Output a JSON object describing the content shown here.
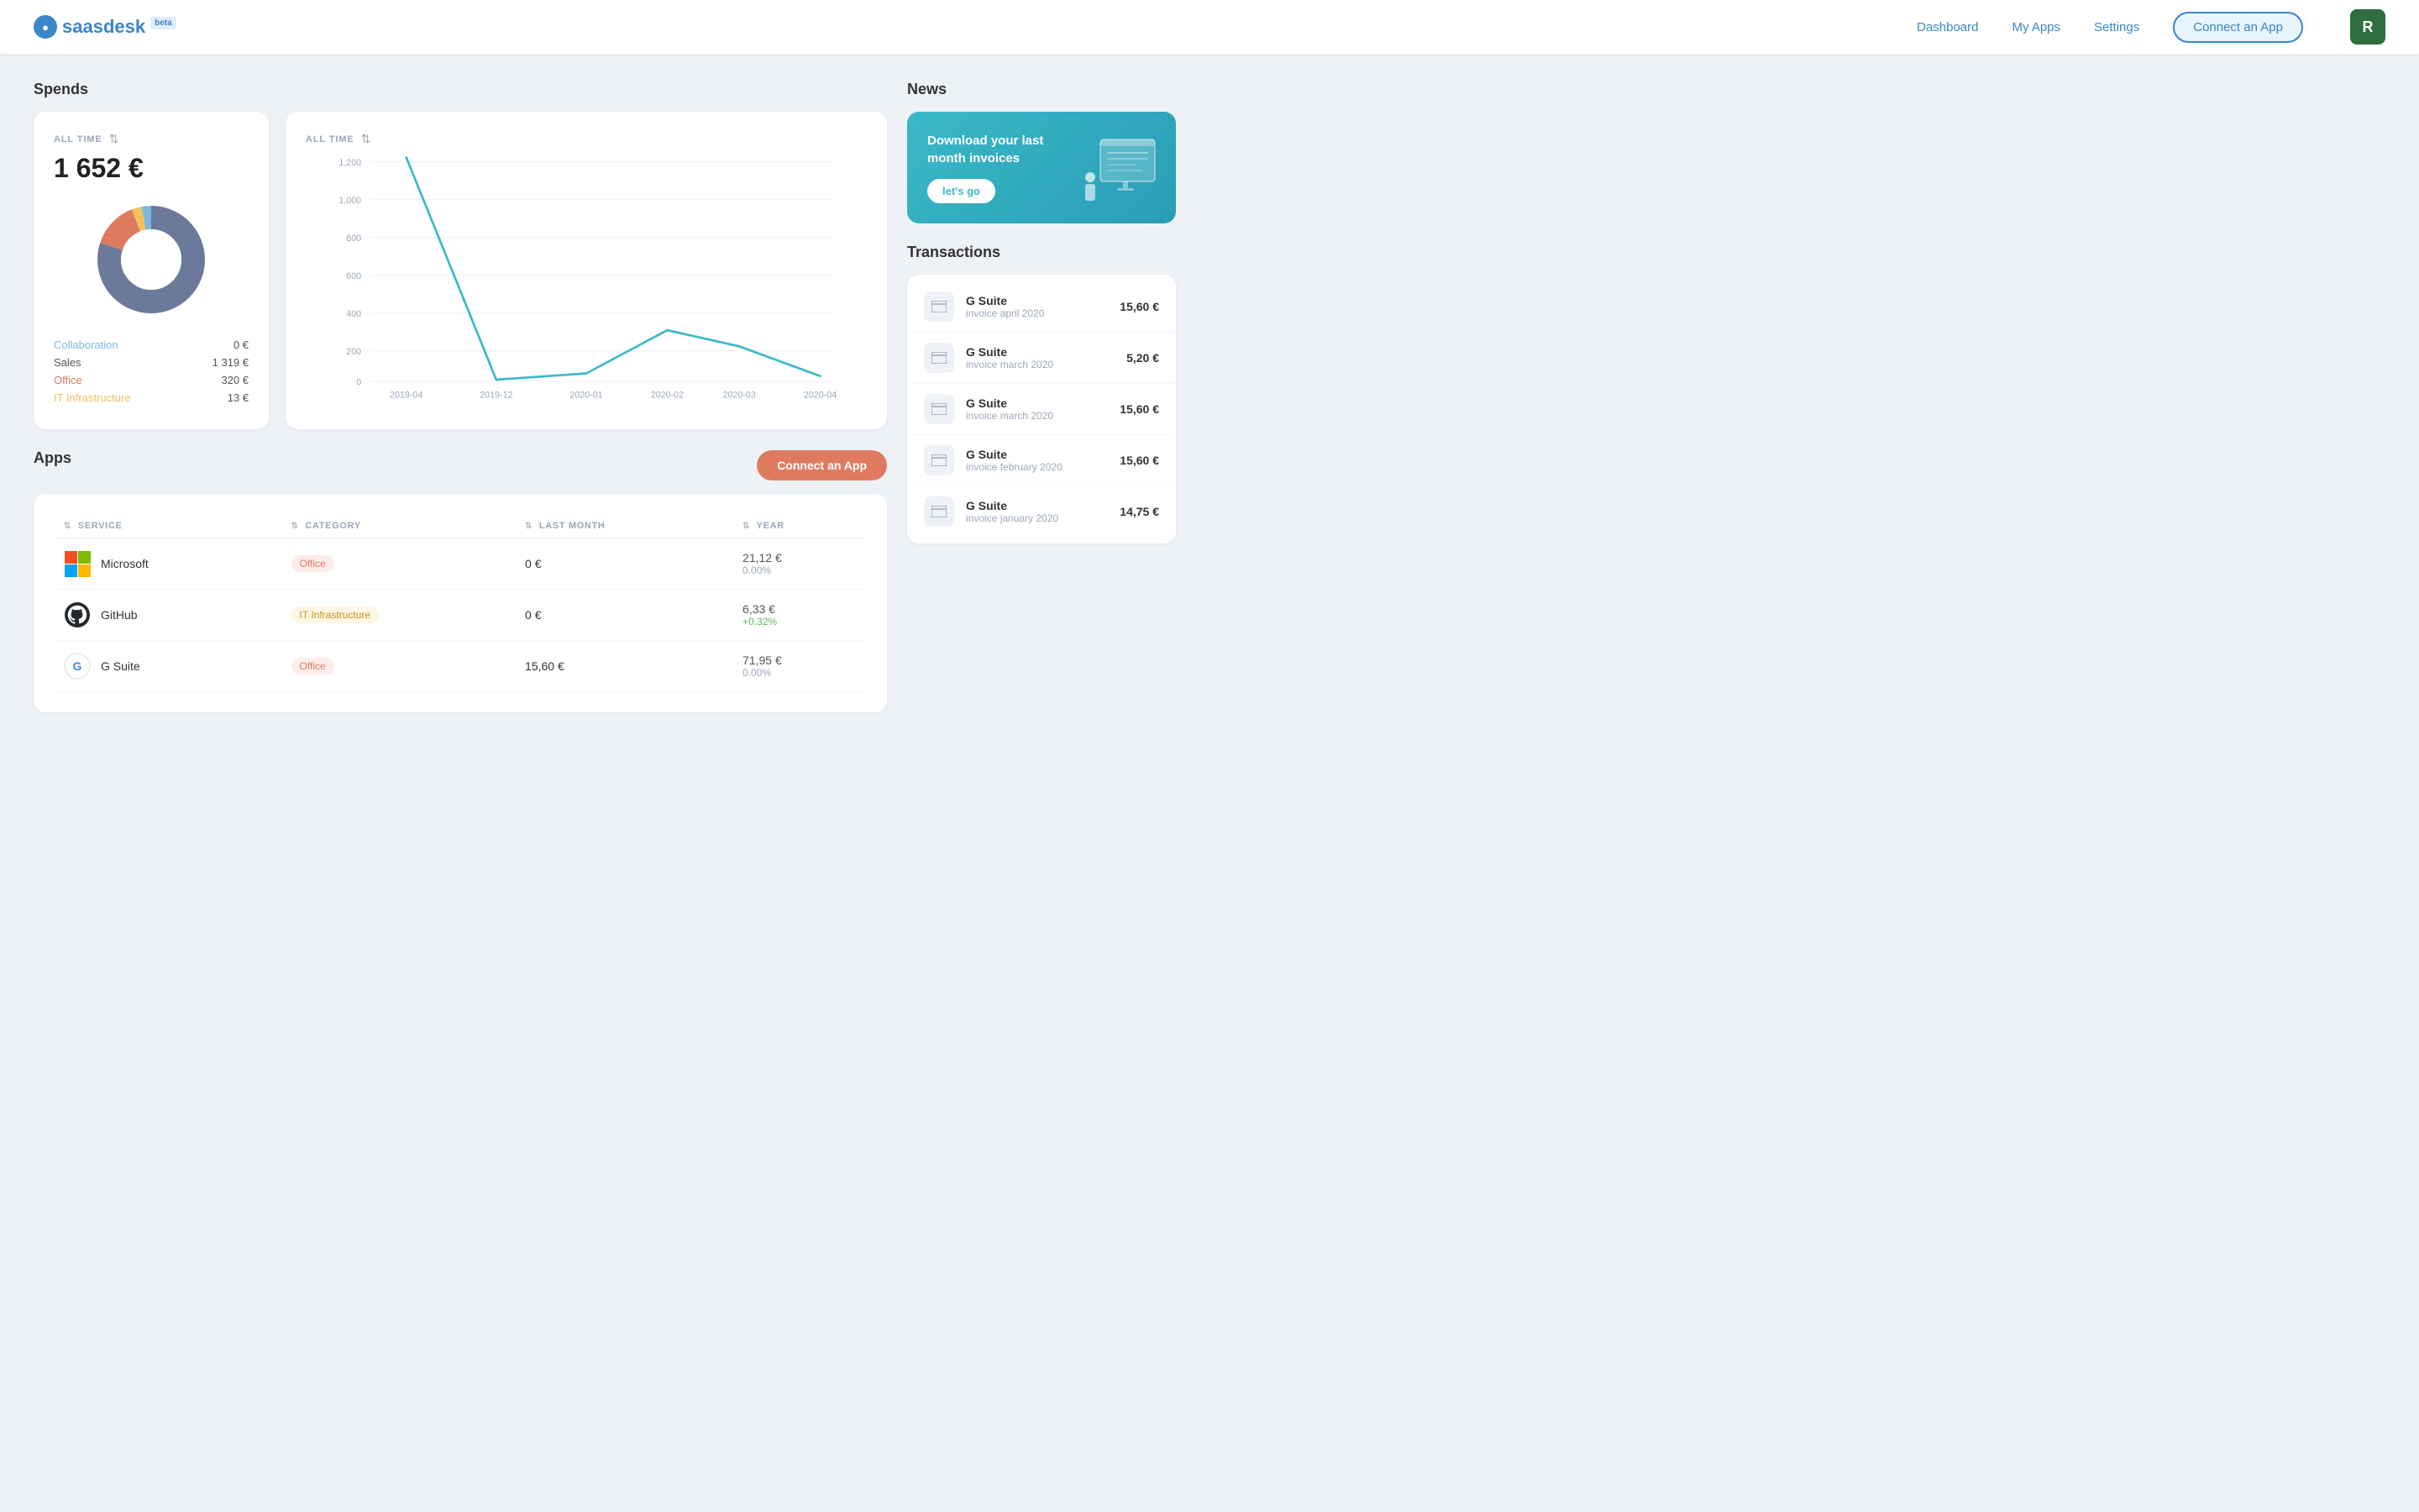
{
  "navbar": {
    "logo_text": "saasdesk",
    "logo_beta": "beta",
    "logo_icon": "●",
    "links": [
      {
        "id": "dashboard",
        "label": "Dashboard"
      },
      {
        "id": "my-apps",
        "label": "My Apps"
      },
      {
        "id": "settings",
        "label": "Settings"
      }
    ],
    "connect_btn": "Connect an App",
    "avatar": "R"
  },
  "spends": {
    "title": "Spends",
    "filter_label": "ALL TIME",
    "total": "1 652 €",
    "donut": {
      "segments": [
        {
          "label": "Collaboration",
          "value": "0 €",
          "color": "#7cb8e0",
          "percent": 3
        },
        {
          "label": "Sales",
          "value": "1 319 €",
          "color": "#6b7a9a",
          "percent": 80
        },
        {
          "label": "Office",
          "value": "320 €",
          "color": "#e07a5f",
          "percent": 14
        },
        {
          "label": "IT Infrastructure",
          "value": "13 €",
          "color": "#f4c05a",
          "percent": 3
        }
      ]
    }
  },
  "chart": {
    "filter_label": "ALL TIME",
    "y_labels": [
      "1,200",
      "1,000",
      "800",
      "600",
      "400",
      "200",
      "0"
    ],
    "x_labels": [
      "2019-04",
      "2019-12",
      "2020-01",
      "2020-02",
      "2020-03",
      "2020-04"
    ]
  },
  "apps": {
    "title": "Apps",
    "connect_btn": "Connect an App",
    "columns": {
      "service": "SERVICE",
      "category": "CATEGORY",
      "last_month": "LAST MONTH",
      "year": "YEAR"
    },
    "rows": [
      {
        "id": "microsoft",
        "name": "Microsoft",
        "logo_emoji": "🟥",
        "category": "Office",
        "category_type": "office",
        "last_month": "0 €",
        "year": "21,12 €",
        "year_percent": "0.00%",
        "percent_positive": false
      },
      {
        "id": "github",
        "name": "GitHub",
        "logo_emoji": "⚫",
        "category": "IT Infrastructure",
        "category_type": "it",
        "last_month": "0 €",
        "year": "6,33 €",
        "year_percent": "+0.32%",
        "percent_positive": true
      },
      {
        "id": "gsuite",
        "name": "G Suite",
        "logo_emoji": "🅖",
        "category": "Office",
        "category_type": "office",
        "last_month": "15,60 €",
        "year": "71,95 €",
        "year_percent": "0.00%",
        "percent_positive": false
      }
    ]
  },
  "news": {
    "title": "News",
    "banner_text": "Download your last month invoices",
    "banner_btn": "let's go"
  },
  "transactions": {
    "title": "Transactions",
    "items": [
      {
        "id": "t1",
        "name": "G Suite",
        "sub": "invoice april 2020",
        "amount": "15,60 €"
      },
      {
        "id": "t2",
        "name": "G Suite",
        "sub": "invoice march 2020",
        "amount": "5,20 €"
      },
      {
        "id": "t3",
        "name": "G Suite",
        "sub": "invoice march 2020",
        "amount": "15,60 €"
      },
      {
        "id": "t4",
        "name": "G Suite",
        "sub": "invoice february 2020",
        "amount": "15,60 €"
      },
      {
        "id": "t5",
        "name": "G Suite",
        "sub": "invoice january 2020",
        "amount": "14,75 €"
      }
    ]
  }
}
